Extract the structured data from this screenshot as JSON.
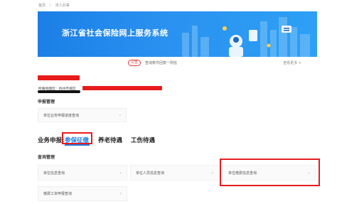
{
  "breadcrumb": {
    "home": "首页",
    "separator": "|",
    "current": "法人办事"
  },
  "banner": {
    "title": "浙江省社会保险网上服务系统"
  },
  "notice": {
    "badge": "公告",
    "text": "查询条件回复一则信",
    "more": "查看更多 >"
  },
  "unit": {
    "area": "所属地图区：杭州市城区"
  },
  "declare_manage": {
    "heading": "申报管理",
    "items": [
      {
        "label": "单位业务申报进度查询"
      }
    ]
  },
  "business": {
    "label": "业务申报:",
    "tabs": [
      {
        "label": "参保征缴",
        "active": true
      },
      {
        "label": "养老待遇",
        "active": false
      },
      {
        "label": "工伤待遇",
        "active": false
      }
    ]
  },
  "query_manage": {
    "heading": "查询管理",
    "items": [
      {
        "label": "单位信息查询"
      },
      {
        "label": "单位人员信息查询"
      },
      {
        "label": "单位缴费信息查询"
      },
      {
        "label": "缴费工资申报查询"
      }
    ]
  },
  "colors": {
    "primary_blue": "#1f7ce0",
    "highlight_red": "#e61e1e",
    "banner_blue": "#2a91f0"
  },
  "icons": {
    "chevron": "chevron-right-icon"
  }
}
